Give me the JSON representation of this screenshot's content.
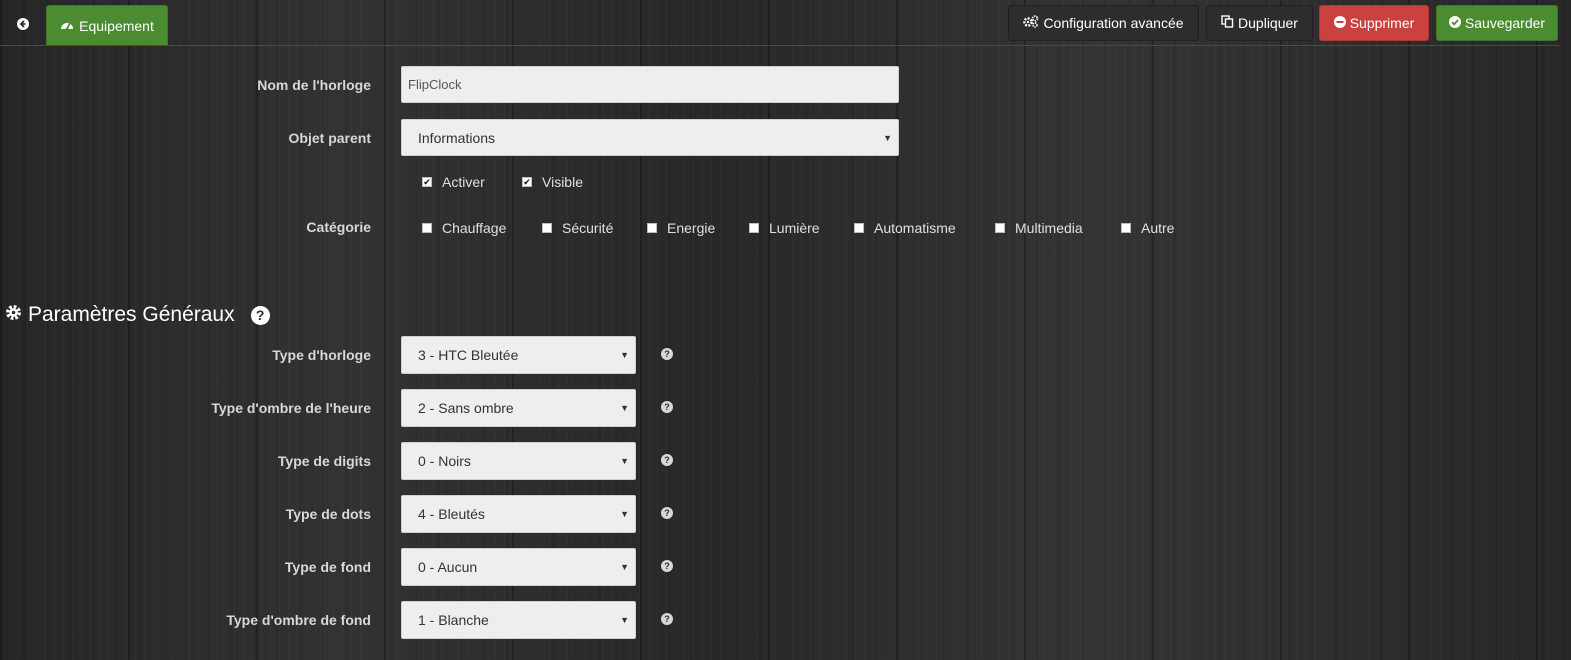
{
  "topbar": {
    "back_icon": "arrow-circle-left-icon",
    "tab_label": "Equipement",
    "tab_icon": "dashboard-icon",
    "buttons": {
      "config_label": "Configuration avancée",
      "duplicate_label": "Dupliquer",
      "delete_label": "Supprimer",
      "save_label": "Sauvegarder"
    },
    "colors": {
      "green": "#4a8c2f",
      "red": "#c9423f",
      "dark": "#2c2d2f"
    }
  },
  "form": {
    "name_label": "Nom de l'horloge",
    "name_value": "FlipClock",
    "parent_label": "Objet parent",
    "parent_value": "Informations",
    "activer_label": "Activer",
    "activer_checked": true,
    "visible_label": "Visible",
    "visible_checked": true,
    "category_label": "Catégorie",
    "categories": [
      {
        "label": "Chauffage",
        "checked": false
      },
      {
        "label": "Sécurité",
        "checked": false
      },
      {
        "label": "Energie",
        "checked": false
      },
      {
        "label": "Lumière",
        "checked": false
      },
      {
        "label": "Automatisme",
        "checked": false
      },
      {
        "label": "Multimedia",
        "checked": false
      },
      {
        "label": "Autre",
        "checked": false
      }
    ]
  },
  "section": {
    "title": "Paramètres Généraux",
    "icon": "gear-icon",
    "help_icon": "question-circle-icon"
  },
  "params": [
    {
      "label": "Type d'horloge",
      "value": "3 - HTC Bleutée"
    },
    {
      "label": "Type d'ombre de l'heure",
      "value": "2 - Sans ombre"
    },
    {
      "label": "Type de digits",
      "value": "0 - Noirs"
    },
    {
      "label": "Type de dots",
      "value": "4 - Bleutés"
    },
    {
      "label": "Type de fond",
      "value": "0 - Aucun"
    },
    {
      "label": "Type d'ombre de fond",
      "value": "1 - Blanche"
    }
  ]
}
